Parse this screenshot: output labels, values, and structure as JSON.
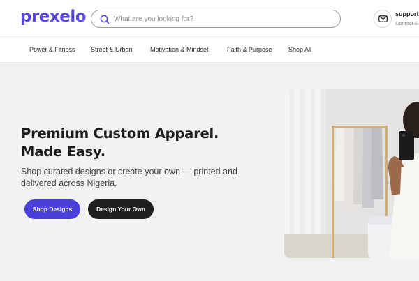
{
  "brand": {
    "logo": "prexelo",
    "accent": "#4b3fdc"
  },
  "search": {
    "placeholder": "What are you looking for?"
  },
  "support": {
    "email": "support@",
    "subtitle": "Contact E"
  },
  "nav": {
    "items": [
      {
        "label": "Power & Fitness"
      },
      {
        "label": "Street & Urban"
      },
      {
        "label": "Motivation & Mindset"
      },
      {
        "label": "Faith & Purpose"
      },
      {
        "label": "Shop All"
      }
    ]
  },
  "hero": {
    "title_line1": "Premium Custom Apparel.",
    "title_line2": "Made Easy.",
    "subtitle": "Shop curated designs or create your own — printed and delivered across Nigeria.",
    "primary_cta": "Shop Designs",
    "secondary_cta": "Design Your Own",
    "image": "woman-taking-mirror-selfie-photo"
  }
}
